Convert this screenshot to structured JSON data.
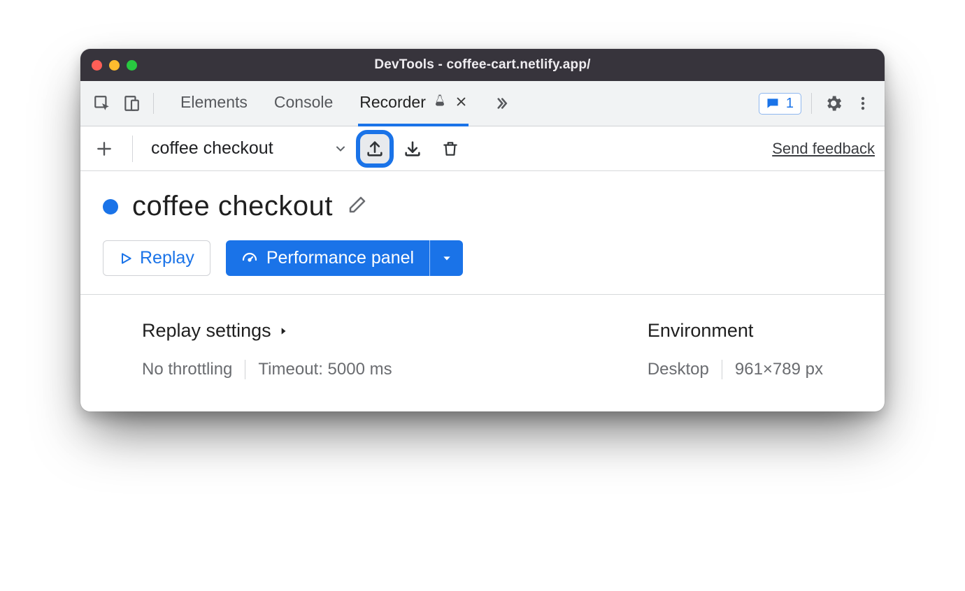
{
  "window": {
    "title": "DevTools - coffee-cart.netlify.app/"
  },
  "toolbar": {
    "tabs": [
      {
        "label": "Elements"
      },
      {
        "label": "Console"
      },
      {
        "label": "Recorder",
        "active": true,
        "closable": true,
        "experimental": true
      }
    ],
    "issues_count": "1"
  },
  "recorderBar": {
    "recording_name": "coffee checkout",
    "feedback_label": "Send feedback"
  },
  "recording": {
    "name": "coffee checkout",
    "replay_label": "Replay",
    "perf_label": "Performance panel"
  },
  "settings": {
    "replay_heading": "Replay settings",
    "throttling": "No throttling",
    "timeout": "Timeout: 5000 ms",
    "env_heading": "Environment",
    "env_device": "Desktop",
    "env_viewport": "961×789 px"
  }
}
